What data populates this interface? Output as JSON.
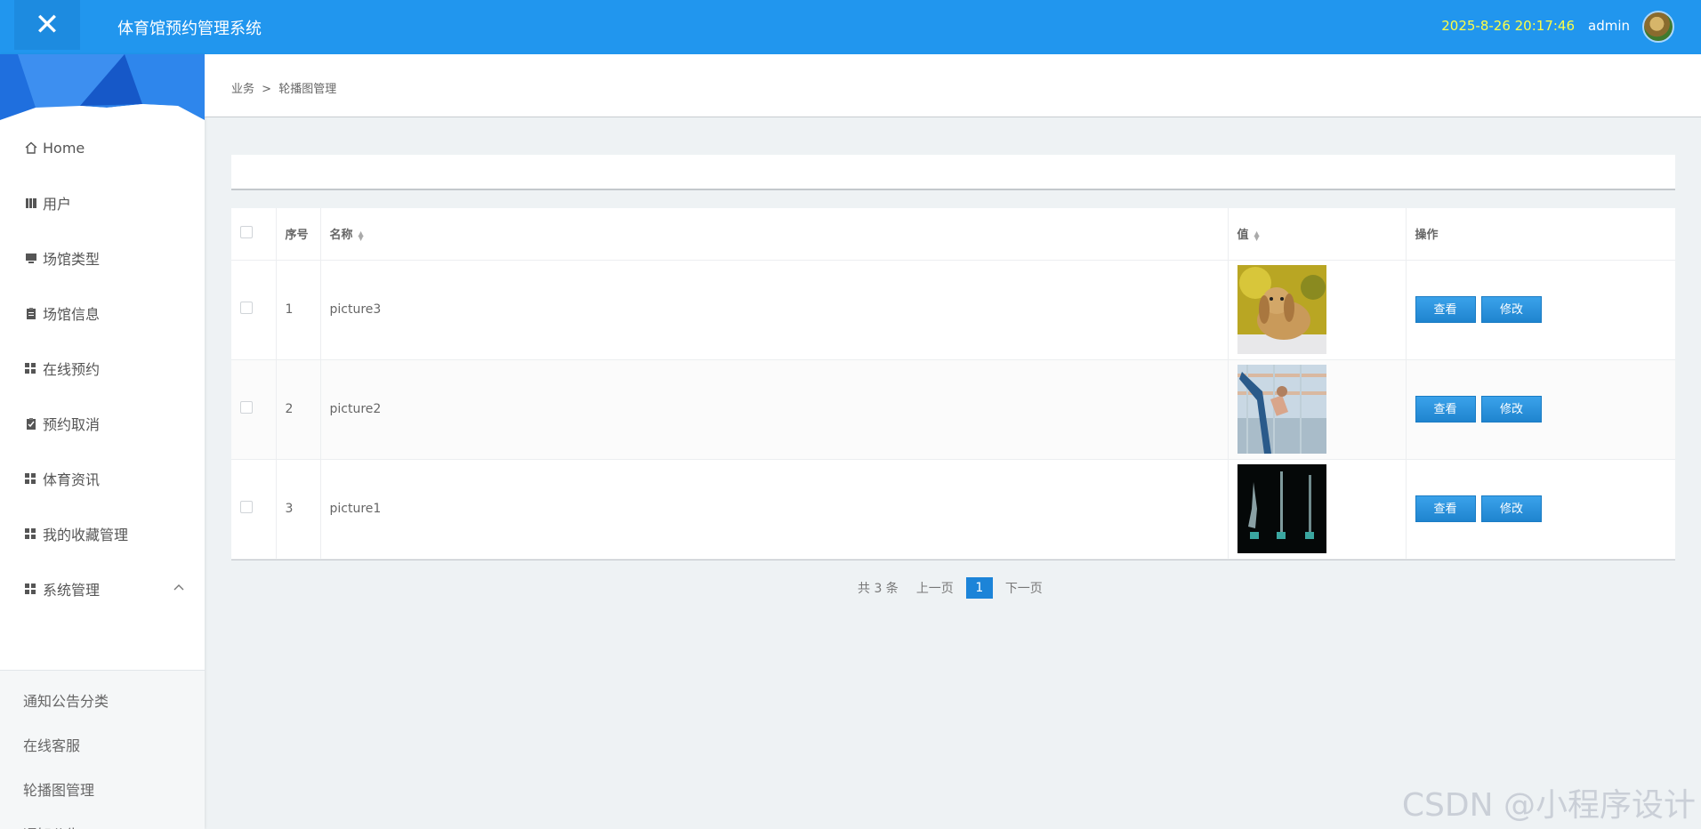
{
  "header": {
    "close_glyph": "✕",
    "title": "体育馆预约管理系统",
    "datetime": "2025-8-26 20:17:46",
    "username": "admin",
    "bg_color": "#2196ee",
    "datetime_color": "#ffff44"
  },
  "sidebar": {
    "items": [
      {
        "label": "Home",
        "icon": "home-icon"
      },
      {
        "label": "用户",
        "icon": "book-icon"
      },
      {
        "label": "场馆类型",
        "icon": "monitor-icon"
      },
      {
        "label": "场馆信息",
        "icon": "clipboard-icon"
      },
      {
        "label": "在线预约",
        "icon": "grid-icon"
      },
      {
        "label": "预约取消",
        "icon": "clipboard-check-icon"
      },
      {
        "label": "体育资讯",
        "icon": "grid-icon"
      },
      {
        "label": "我的收藏管理",
        "icon": "grid-icon"
      },
      {
        "label": "系统管理",
        "icon": "grid-icon",
        "expanded": true
      }
    ],
    "subitems": [
      "通知公告分类",
      "在线客服",
      "轮播图管理",
      "通知公告"
    ]
  },
  "breadcrumb": {
    "parent": "业务",
    "separator": ">",
    "current": "轮播图管理"
  },
  "table": {
    "columns": [
      "序号",
      "名称",
      "值",
      "操作"
    ],
    "rows": [
      {
        "index": "1",
        "name": "picture3",
        "image": "rabbit-photo",
        "view": "查看",
        "edit": "修改"
      },
      {
        "index": "2",
        "name": "picture2",
        "image": "gymnast-photo",
        "view": "查看",
        "edit": "修改"
      },
      {
        "index": "3",
        "name": "picture1",
        "image": "dark-figures-photo",
        "view": "查看",
        "edit": "修改"
      }
    ]
  },
  "pagination": {
    "total": "共 3 条",
    "prev": "上一页",
    "current": "1",
    "next": "下一页"
  },
  "watermark": "CSDN @小程序设计"
}
